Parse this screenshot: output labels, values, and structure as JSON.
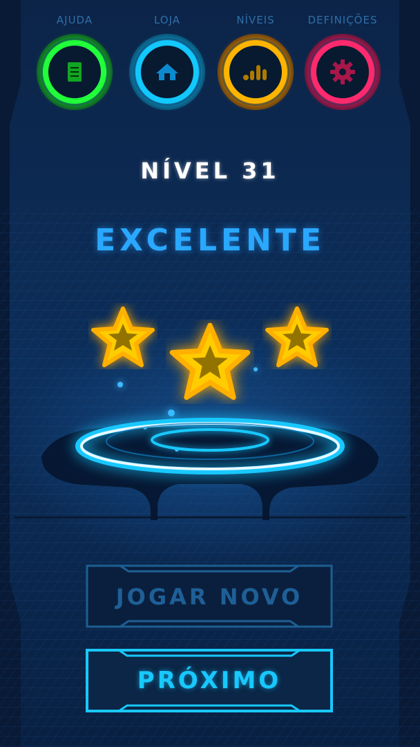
{
  "nav": {
    "items": [
      {
        "label": "AJUDA",
        "icon": "document-icon",
        "color": "#21ff3a"
      },
      {
        "label": "LOJA",
        "icon": "home-icon",
        "color": "#12c8ff"
      },
      {
        "label": "NÍVEIS",
        "icon": "bar-chart-icon",
        "color": "#ffb400"
      },
      {
        "label": "DEFINIÇÕES",
        "icon": "gear-icon",
        "color": "#ff2a6d"
      }
    ]
  },
  "result": {
    "level_title": "NÍVEL 31",
    "rating_text": "EXCELENTE",
    "stars_earned": 3,
    "stars_total": 3,
    "star_color": "#ffcc00"
  },
  "actions": {
    "replay_label": "JOGAR NOVO",
    "next_label": "PRÓXIMO"
  },
  "colors": {
    "background": "#0a1f3e",
    "accent": "#18c8ff",
    "title_blue": "#2aa8ff"
  }
}
